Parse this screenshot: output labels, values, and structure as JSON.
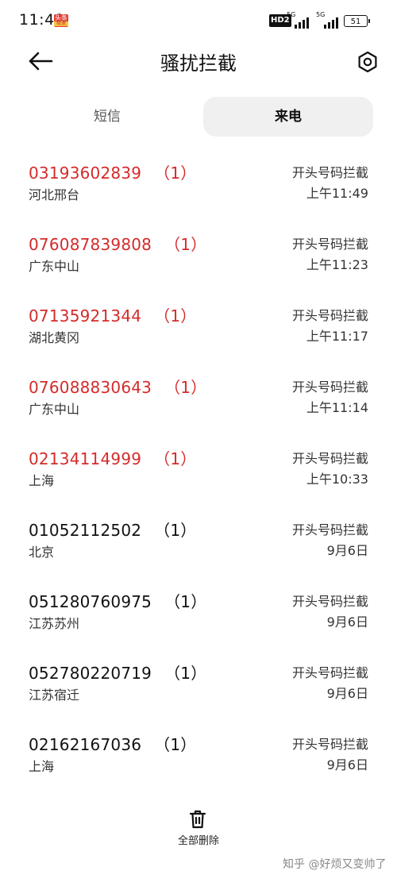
{
  "status_bar": {
    "time": "11:49",
    "app_badge_l1": "头条",
    "app_badge_l2": "极速",
    "hd": "HD2",
    "signal1_label": "5G",
    "signal2_label": "5G",
    "battery": "51"
  },
  "header": {
    "title": "骚扰拦截"
  },
  "tabs": [
    {
      "label": "短信",
      "active": false
    },
    {
      "label": "来电",
      "active": true
    }
  ],
  "calls": [
    {
      "number": "03193602839",
      "count": "（1）",
      "location": "河北邢台",
      "reason": "开头号码拦截",
      "time": "上午11:49",
      "highlighted": true
    },
    {
      "number": "076087839808",
      "count": "（1）",
      "location": "广东中山",
      "reason": "开头号码拦截",
      "time": "上午11:23",
      "highlighted": true
    },
    {
      "number": "07135921344",
      "count": "（1）",
      "location": "湖北黄冈",
      "reason": "开头号码拦截",
      "time": "上午11:17",
      "highlighted": true
    },
    {
      "number": "076088830643",
      "count": "（1）",
      "location": "广东中山",
      "reason": "开头号码拦截",
      "time": "上午11:14",
      "highlighted": true
    },
    {
      "number": "02134114999",
      "count": "（1）",
      "location": "上海",
      "reason": "开头号码拦截",
      "time": "上午10:33",
      "highlighted": true
    },
    {
      "number": "01052112502",
      "count": "（1）",
      "location": "北京",
      "reason": "开头号码拦截",
      "time": "9月6日",
      "highlighted": false
    },
    {
      "number": "051280760975",
      "count": "（1）",
      "location": "江苏苏州",
      "reason": "开头号码拦截",
      "time": "9月6日",
      "highlighted": false
    },
    {
      "number": "052780220719",
      "count": "（1）",
      "location": "江苏宿迁",
      "reason": "开头号码拦截",
      "time": "9月6日",
      "highlighted": false
    },
    {
      "number": "02162167036",
      "count": "（1）",
      "location": "上海",
      "reason": "开头号码拦截",
      "time": "9月6日",
      "highlighted": false
    }
  ],
  "bottom": {
    "delete_all_label": "全部删除"
  },
  "watermark": "知乎 @好烦又变帅了",
  "colors": {
    "highlight": "#d42b2b",
    "tab_active_bg": "#f0f0f0"
  }
}
